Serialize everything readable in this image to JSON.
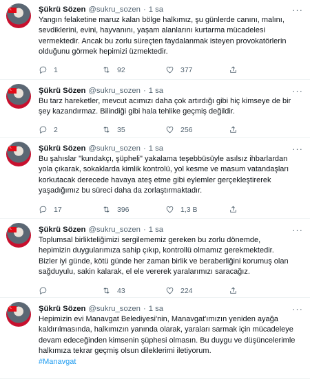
{
  "tweets": [
    {
      "name": "Şükrü Sözen",
      "handle": "@sukru_sozen",
      "dot": "·",
      "time": "1 sa",
      "text": "Yangın felaketine maruz kalan bölge halkımız, şu günlerde canını, malını,\nsevdiklerini, evini, hayvanını, yaşam alanlarını kurtarma mücadelesi\nvermektedir. Ancak bu zorlu süreçten faydalanmak isteyen provokatörlerin\nolduğunu görmek hepimizi üzmektedir.",
      "replies": "1",
      "retweets": "92",
      "likes": "377"
    },
    {
      "name": "Şükrü Sözen",
      "handle": "@sukru_sozen",
      "dot": "·",
      "time": "1 sa",
      "text": "Bu tarz hareketler, mevcut acımızı daha çok artırdığı gibi hiç kimseye de bir\nşey kazandırmaz. Bilindiği gibi hala tehlike geçmiş değildir.",
      "replies": "2",
      "retweets": "35",
      "likes": "256"
    },
    {
      "name": "Şükrü Sözen",
      "handle": "@sukru_sozen",
      "dot": "·",
      "time": "1 sa",
      "text": "Bu şahıslar \"kundakçı, şüpheli\" yakalama teşebbüsüyle asılsız ihbarlardan\nyola çıkarak, sokaklarda kimlik kontrolü, yol kesme ve masum vatandaşları\nkorkutacak derecede havaya ateş etme gibi eylemler gerçekleştirerek\nyaşadığımız bu süreci daha da zorlaştırmaktadır.",
      "replies": "17",
      "retweets": "396",
      "likes": "1,3 B"
    },
    {
      "name": "Şükrü Sözen",
      "handle": "@sukru_sozen",
      "dot": "·",
      "time": "1 sa",
      "text": "Toplumsal birlikteliğimizi  sergilememiz gereken bu zorlu dönemde,\nhepimizin duygularımıza sahip çıkıp, kontrollü olmamız gerekmektedir.\nBizler iyi günde, kötü günde her zaman birlik ve beraberliğini korumuş olan\nsağduyulu,  sakin kalarak, el ele vererek yaralarımızı saracağız.",
      "replies": "",
      "retweets": "43",
      "likes": "224"
    },
    {
      "name": "Şükrü Sözen",
      "handle": "@sukru_sozen",
      "dot": "·",
      "time": "1 sa",
      "text": "Hepimizin evi Manavgat Belediyesi'nin, Manavgat'ımızın yeniden ayağa\nkaldırılmasında, halkımızın yanında olarak, yaraları sarmak için mücadeleye\ndevam edeceğinden kimsenin şüphesi olmasın. Bu duygu ve düşüncelerimle\nhalkımıza tekrar geçmiş olsun dileklerimi iletiyorum.",
      "hashtag": "#Manavgat"
    }
  ],
  "more_glyph": "···"
}
